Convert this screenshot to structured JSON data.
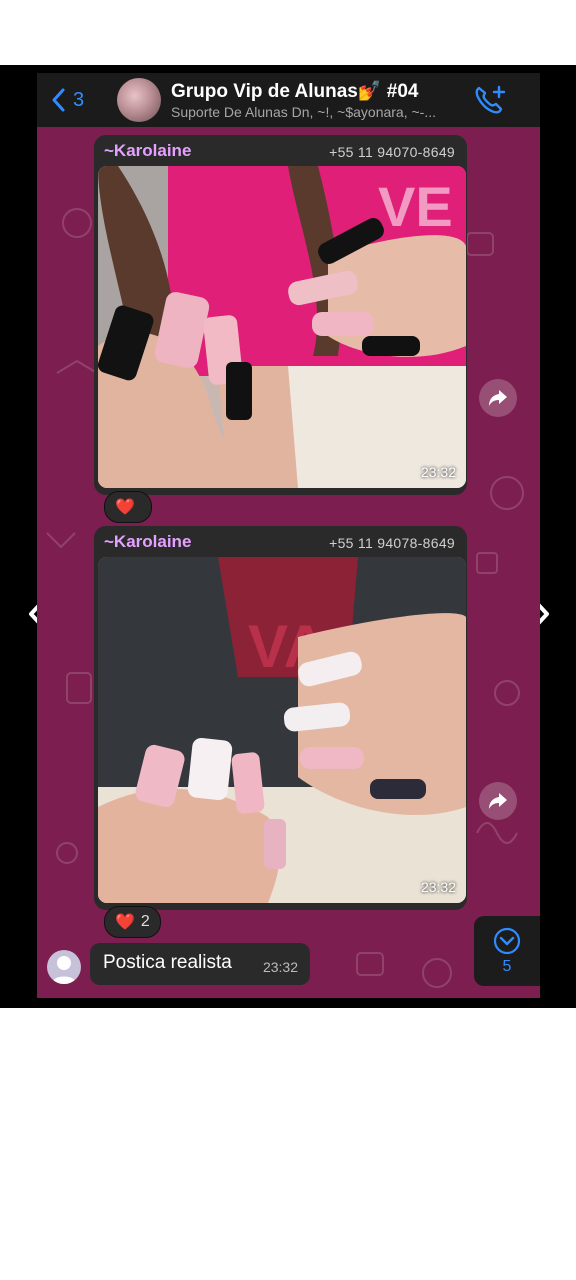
{
  "header": {
    "back_count": "3",
    "title": "Grupo Vip de Alunas💅 #04",
    "subtitle": "Suporte De Alunas Dn, ~!, ~$ayonara, ~-..."
  },
  "messages": [
    {
      "sender": "~Karolaine",
      "phone": "+55 11 94070-8649",
      "time": "23:32",
      "reaction": "❤️",
      "reaction_count": ""
    },
    {
      "sender": "~Karolaine",
      "phone": "+55 11 94078-8649",
      "time": "23:32",
      "reaction": "❤️",
      "reaction_count": "2"
    }
  ],
  "text_message": {
    "text": "Postica realista",
    "time": "23:32"
  },
  "scroll_down": {
    "count": "5"
  },
  "colors": {
    "chat_bg": "#7c1e4f",
    "bubble": "#2a2a2a",
    "sender": "#e5a1ff",
    "accent": "#2f8cff"
  },
  "icons": [
    "chevron-left-icon",
    "group-avatar",
    "phone-add-icon",
    "forward-icon",
    "heart-icon",
    "user-avatar-icon",
    "chevron-down-circle-icon",
    "chevron-right-icon"
  ]
}
